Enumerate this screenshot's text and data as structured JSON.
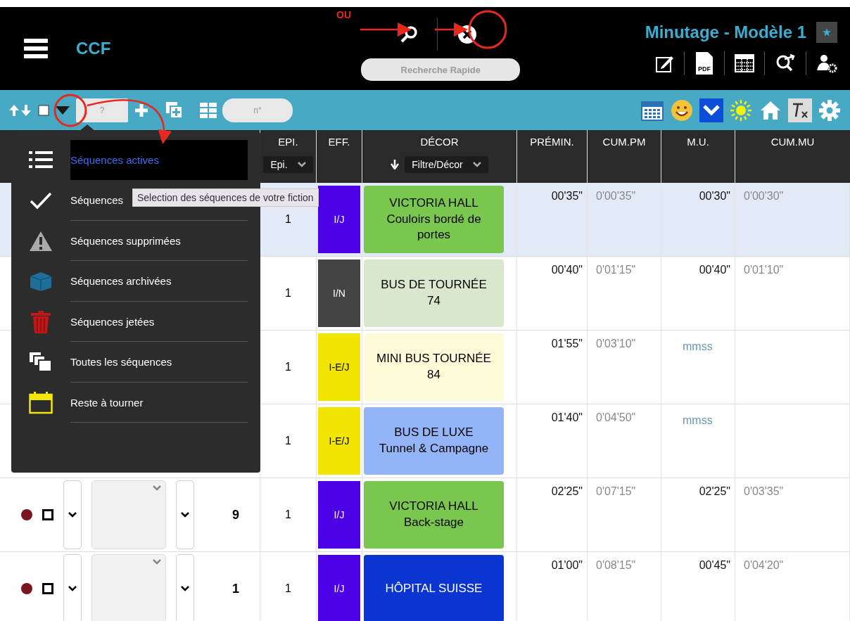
{
  "header": {
    "app_name": "CCF",
    "title": "Minutage - Modèle 1",
    "search": {
      "placeholder": "Recherche Rapide"
    },
    "pdf_label": "PDF"
  },
  "annotation": {
    "label": "OU"
  },
  "toolbar": {
    "number_field": {
      "placeholder": "?"
    },
    "scene_field": {
      "placeholder": "n°"
    }
  },
  "table": {
    "columns": [
      {
        "label": "EPI.",
        "filter": "Epi."
      },
      {
        "label": "EFF."
      },
      {
        "label": "DÉCOR",
        "filter": "Filtre/Décor"
      },
      {
        "label": "PRÉMIN."
      },
      {
        "label": "CUM.PM"
      },
      {
        "label": "M.U."
      },
      {
        "label": "CUM.MU"
      }
    ],
    "rows": [
      {
        "selected": true,
        "epi": "1",
        "eff": {
          "label": "I/J",
          "color": "#4b00e6"
        },
        "decor": {
          "lines": [
            "VICTORIA HALL",
            "Couloirs bordé de portes"
          ],
          "color": "#7ac74f"
        },
        "premin": "00'35\"",
        "cum_pm": "0'00'35\"",
        "mu": "00'30\"",
        "cum_mu": "0'00'30\""
      },
      {
        "selected": false,
        "epi": "1",
        "eff": {
          "label": "I/N",
          "color": "#444444"
        },
        "decor": {
          "lines": [
            "BUS DE TOURNÉE 74"
          ],
          "color": "#d9e8cc"
        },
        "premin": "00'40\"",
        "cum_pm": "0'01'15\"",
        "mu": "00'40\"",
        "cum_mu": "0'01'10\""
      },
      {
        "selected": false,
        "epi": "1",
        "eff": {
          "label": "I-E/J",
          "color": "#f2e600"
        },
        "decor": {
          "lines": [
            "MINI BUS TOURNÉE 84"
          ],
          "color": "#fdfbd8"
        },
        "premin": "01'55\"",
        "cum_pm": "0'03'10\"",
        "mu_placeholder": "mmss"
      },
      {
        "selected": false,
        "epi": "1",
        "eff": {
          "label": "I-E/J",
          "color": "#f2e600"
        },
        "decor": {
          "lines": [
            "BUS DE LUXE",
            "Tunnel & Campagne"
          ],
          "color": "#94b4f8"
        },
        "premin": "01'40\"",
        "cum_pm": "0'04'50\"",
        "mu_placeholder": "mmss"
      },
      {
        "selected": false,
        "lead": {
          "checked": false,
          "number": "9"
        },
        "epi": "1",
        "eff": {
          "label": "I/J",
          "color": "#4b00e6"
        },
        "decor": {
          "lines": [
            "VICTORIA HALL",
            "Back-stage"
          ],
          "color": "#7ac74f"
        },
        "premin": "02'25\"",
        "cum_pm": "0'07'15\"",
        "mu": "02'25\"",
        "cum_mu": "0'03'35\""
      },
      {
        "selected": false,
        "lead": {
          "checked": false,
          "number": "1"
        },
        "epi": "1",
        "eff": {
          "label": "I/J",
          "color": "#4b00e6"
        },
        "decor": {
          "lines": [
            "HÔPITAL SUISSE"
          ],
          "color": "#0a35d0"
        },
        "premin": "01'00\"",
        "cum_pm": "0'08'15\"",
        "mu": "00'45\"",
        "cum_mu": "0'04'20\""
      }
    ]
  },
  "menu": {
    "items": [
      {
        "kind": "list",
        "label": "Séquences actives",
        "selected": true
      },
      {
        "kind": "check",
        "label": "Séquences",
        "selected": false
      },
      {
        "kind": "warning",
        "label": "Séquences supprimées",
        "selected": false
      },
      {
        "kind": "box",
        "label": "Séquences archivées",
        "selected": false
      },
      {
        "kind": "trash",
        "label": "Séquences jetées",
        "selected": false
      },
      {
        "kind": "copy",
        "label": "Toutes les séquences",
        "selected": false
      },
      {
        "kind": "calendar",
        "label": "Reste à tourner",
        "selected": false
      }
    ]
  },
  "tooltip": "Selection des séquences de votre fiction"
}
